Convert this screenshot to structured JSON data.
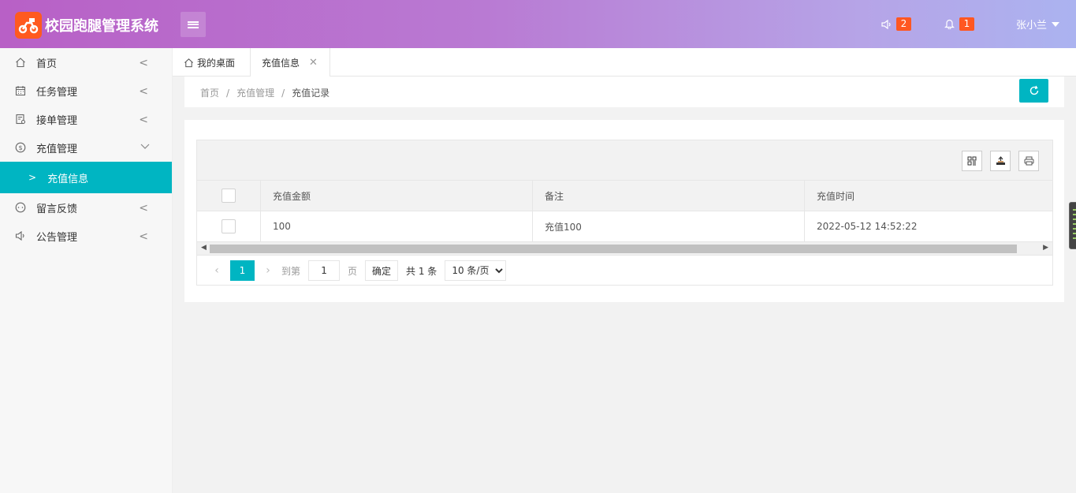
{
  "app": {
    "title": "校园跑腿管理系统",
    "brand_color": "#ff5a1f",
    "accent_color": "#00b5c2"
  },
  "header": {
    "notices_icon": "speaker-icon",
    "notices_count": "2",
    "alerts_icon": "bell-icon",
    "alerts_count": "1",
    "user_name": "张小兰"
  },
  "sidebar": {
    "items": [
      {
        "label": "首页",
        "icon": "home-icon"
      },
      {
        "label": "任务管理",
        "icon": "calendar-icon"
      },
      {
        "label": "接单管理",
        "icon": "order-icon"
      },
      {
        "label": "充值管理",
        "icon": "dollar-icon",
        "expanded": true
      },
      {
        "label": "留言反馈",
        "icon": "chat-icon"
      },
      {
        "label": "公告管理",
        "icon": "speaker-icon"
      }
    ],
    "active_sub": "充值信息"
  },
  "tabs": {
    "home": "我的桌面",
    "active": "充值信息"
  },
  "breadcrumb": {
    "items": [
      "首页",
      "充值管理",
      "充值记录"
    ]
  },
  "table": {
    "toolbar": [
      "columns-icon",
      "export-icon",
      "print-icon"
    ],
    "columns": [
      "充值金额",
      "备注",
      "充值时间"
    ],
    "rows": [
      {
        "amount": "100",
        "note": "充值100",
        "time": "2022-05-12 14:52:22"
      }
    ]
  },
  "pagination": {
    "current": "1",
    "goto_label": "到第",
    "goto_value": "1",
    "page_label": "页",
    "confirm": "确定",
    "total": "共 1 条",
    "page_size": "10 条/页"
  }
}
